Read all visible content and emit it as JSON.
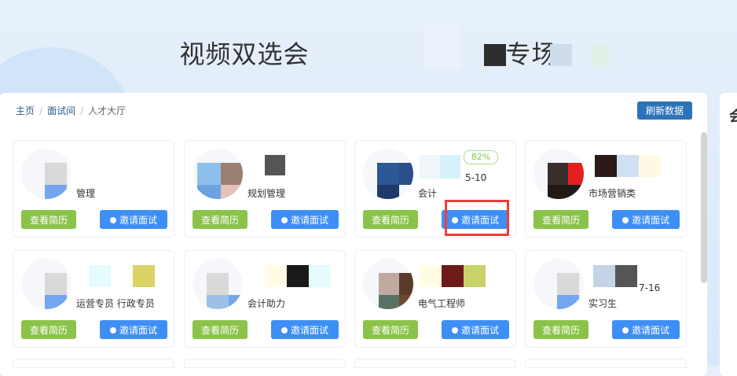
{
  "header": {
    "title": "视频双选会",
    "title_suffix": "专场"
  },
  "breadcrumb": [
    {
      "label": "主页",
      "link": true
    },
    {
      "label": "面试间",
      "link": true
    },
    {
      "label": "人才大厅",
      "link": false
    }
  ],
  "refresh_button": "刷新数据",
  "side_panel_glyph": "会",
  "card_buttons": {
    "view": "查看简历",
    "invite": "邀请面试"
  },
  "cards": [
    {
      "job": "管理",
      "match": ""
    },
    {
      "job": "规划管理",
      "match": ""
    },
    {
      "job": "会计",
      "match": "82%",
      "extra": "5-10"
    },
    {
      "job": "市场营销类",
      "match": ""
    },
    {
      "job": "运营专员 行政专员",
      "match": ""
    },
    {
      "job": "会计助力",
      "match": ""
    },
    {
      "job": "电气工程师",
      "match": ""
    },
    {
      "job": "实习生",
      "match": "",
      "extra": "7-16"
    }
  ],
  "colors": {
    "accent_green": "#8bc34a",
    "accent_blue": "#3d8ff5",
    "refresh_bg": "#2d73b8",
    "highlight": "#f03b3b"
  }
}
